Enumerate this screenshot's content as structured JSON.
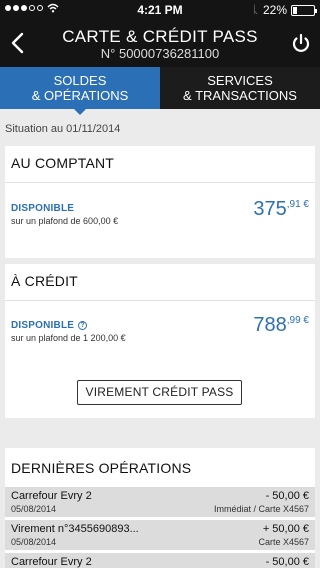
{
  "status_bar": {
    "time": "4:21 PM",
    "battery_percent": "22%",
    "battery_level": 0.22
  },
  "header": {
    "title": "CARTE & CRÉDIT PASS",
    "subtitle": "N° 50000736281100"
  },
  "tabs": [
    {
      "line1": "SOLDES",
      "line2": "& OPÉRATIONS",
      "active": true
    },
    {
      "line1": "SERVICES",
      "line2": "& TRANSACTIONS",
      "active": false
    }
  ],
  "situation": "Situation au 01/11/2014",
  "comptant": {
    "title": "AU COMPTANT",
    "label": "DISPONIBLE",
    "sub": "sur un plafond de 600,00 €",
    "amount_int": "375",
    "amount_cents": ",91 €"
  },
  "credit": {
    "title": "À CRÉDIT",
    "label": "DISPONIBLE",
    "info_icon": "?",
    "sub": "sur un plafond de 1 200,00 €",
    "amount_int": "788",
    "amount_cents": ",99 €",
    "button": "VIREMENT CRÉDIT PASS"
  },
  "operations": {
    "title": "DERNIÈRES OPÉRATIONS",
    "items": [
      {
        "label": "Carrefour Evry 2",
        "date": "05/08/2014",
        "amount": "- 50,00 €",
        "detail": "Immédiat / Carte X4567"
      },
      {
        "label": "Virement n°3455690893...",
        "date": "05/08/2014",
        "amount": "+ 50,00 €",
        "detail": "Carte X4567"
      },
      {
        "label": "Carrefour Evry 2",
        "date": "",
        "amount": "- 50,00 €",
        "detail": ""
      }
    ]
  },
  "colors": {
    "accent": "#2b6fb6",
    "header_bg": "#141414",
    "page_bg": "#ebebeb",
    "row_bg": "#dcdcdc"
  }
}
